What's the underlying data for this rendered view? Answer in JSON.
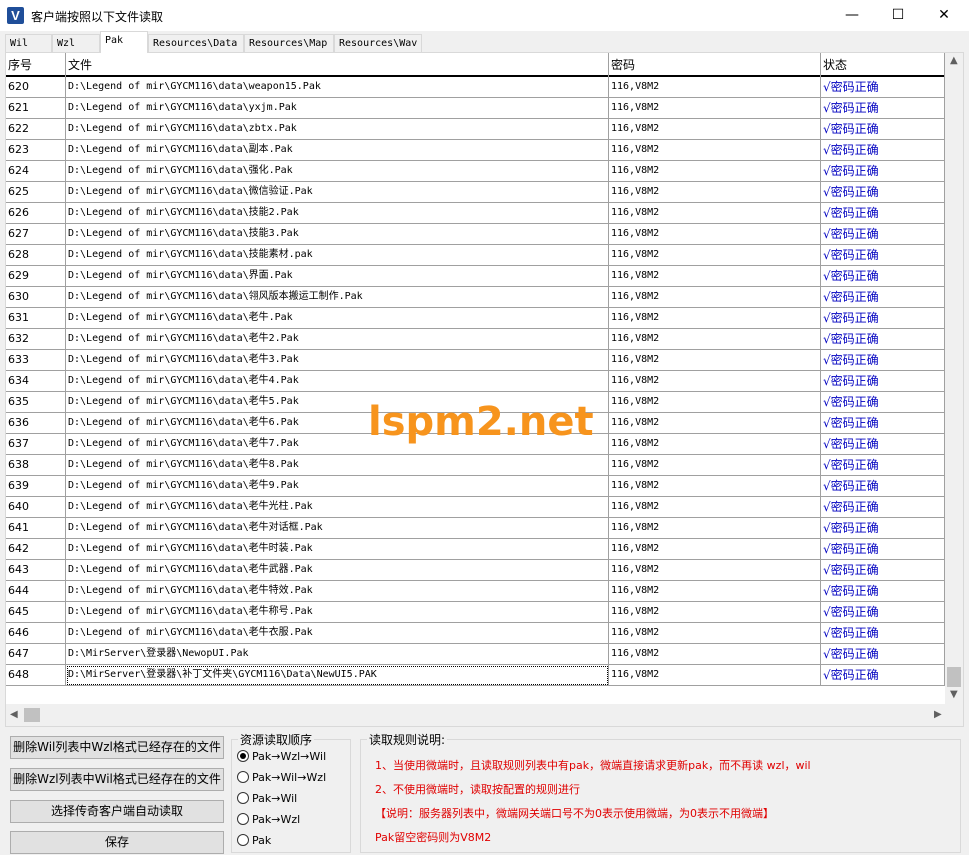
{
  "window": {
    "title": "客户端按照以下文件读取",
    "icon": "V",
    "min": "—",
    "max": "☐",
    "close": "✕"
  },
  "tabs": [
    "Wil",
    "Wzl",
    "Pak",
    "Resources\\Data",
    "Resources\\Map",
    "Resources\\Wav"
  ],
  "active_tab": "Pak",
  "table": {
    "headers": [
      "序号",
      "文件",
      "密码",
      "状态"
    ],
    "rows": [
      [
        "620",
        "D:\\Legend of mir\\GYCM116\\data\\weapon15.Pak",
        "116,V8M2",
        "√密码正确"
      ],
      [
        "621",
        "D:\\Legend of mir\\GYCM116\\data\\yxjm.Pak",
        "116,V8M2",
        "√密码正确"
      ],
      [
        "622",
        "D:\\Legend of mir\\GYCM116\\data\\zbtx.Pak",
        "116,V8M2",
        "√密码正确"
      ],
      [
        "623",
        "D:\\Legend of mir\\GYCM116\\data\\副本.Pak",
        "116,V8M2",
        "√密码正确"
      ],
      [
        "624",
        "D:\\Legend of mir\\GYCM116\\data\\强化.Pak",
        "116,V8M2",
        "√密码正确"
      ],
      [
        "625",
        "D:\\Legend of mir\\GYCM116\\data\\微信验证.Pak",
        "116,V8M2",
        "√密码正确"
      ],
      [
        "626",
        "D:\\Legend of mir\\GYCM116\\data\\技能2.Pak",
        "116,V8M2",
        "√密码正确"
      ],
      [
        "627",
        "D:\\Legend of mir\\GYCM116\\data\\技能3.Pak",
        "116,V8M2",
        "√密码正确"
      ],
      [
        "628",
        "D:\\Legend of mir\\GYCM116\\data\\技能素材.pak",
        "116,V8M2",
        "√密码正确"
      ],
      [
        "629",
        "D:\\Legend of mir\\GYCM116\\data\\界面.Pak",
        "116,V8M2",
        "√密码正确"
      ],
      [
        "630",
        "D:\\Legend of mir\\GYCM116\\data\\翎风版本搬运工制作.Pak",
        "116,V8M2",
        "√密码正确"
      ],
      [
        "631",
        "D:\\Legend of mir\\GYCM116\\data\\老牛.Pak",
        "116,V8M2",
        "√密码正确"
      ],
      [
        "632",
        "D:\\Legend of mir\\GYCM116\\data\\老牛2.Pak",
        "116,V8M2",
        "√密码正确"
      ],
      [
        "633",
        "D:\\Legend of mir\\GYCM116\\data\\老牛3.Pak",
        "116,V8M2",
        "√密码正确"
      ],
      [
        "634",
        "D:\\Legend of mir\\GYCM116\\data\\老牛4.Pak",
        "116,V8M2",
        "√密码正确"
      ],
      [
        "635",
        "D:\\Legend of mir\\GYCM116\\data\\老牛5.Pak",
        "116,V8M2",
        "√密码正确"
      ],
      [
        "636",
        "D:\\Legend of mir\\GYCM116\\data\\老牛6.Pak",
        "116,V8M2",
        "√密码正确"
      ],
      [
        "637",
        "D:\\Legend of mir\\GYCM116\\data\\老牛7.Pak",
        "116,V8M2",
        "√密码正确"
      ],
      [
        "638",
        "D:\\Legend of mir\\GYCM116\\data\\老牛8.Pak",
        "116,V8M2",
        "√密码正确"
      ],
      [
        "639",
        "D:\\Legend of mir\\GYCM116\\data\\老牛9.Pak",
        "116,V8M2",
        "√密码正确"
      ],
      [
        "640",
        "D:\\Legend of mir\\GYCM116\\data\\老牛光柱.Pak",
        "116,V8M2",
        "√密码正确"
      ],
      [
        "641",
        "D:\\Legend of mir\\GYCM116\\data\\老牛对话框.Pak",
        "116,V8M2",
        "√密码正确"
      ],
      [
        "642",
        "D:\\Legend of mir\\GYCM116\\data\\老牛时装.Pak",
        "116,V8M2",
        "√密码正确"
      ],
      [
        "643",
        "D:\\Legend of mir\\GYCM116\\data\\老牛武器.Pak",
        "116,V8M2",
        "√密码正确"
      ],
      [
        "644",
        "D:\\Legend of mir\\GYCM116\\data\\老牛特效.Pak",
        "116,V8M2",
        "√密码正确"
      ],
      [
        "645",
        "D:\\Legend of mir\\GYCM116\\data\\老牛称号.Pak",
        "116,V8M2",
        "√密码正确"
      ],
      [
        "646",
        "D:\\Legend of mir\\GYCM116\\data\\老牛衣服.Pak",
        "116,V8M2",
        "√密码正确"
      ],
      [
        "647",
        "D:\\MirServer\\登录器\\NewopUI.Pak",
        "116,V8M2",
        "√密码正确"
      ],
      [
        "648",
        "D:\\MirServer\\登录器\\补丁文件夹\\GYCM116\\Data\\NewUI5.PAK",
        "116,V8M2",
        "√密码正确"
      ]
    ]
  },
  "watermark": "lspm2.net",
  "buttons": {
    "delete_wil": "删除Wil列表中Wzl格式已经存在的文件",
    "delete_wzl": "删除Wzl列表中Wil格式已经存在的文件",
    "auto_read": "选择传奇客户端自动读取",
    "save": "保存"
  },
  "order_group": {
    "title": "资源读取顺序",
    "options": [
      "Pak→Wzl→Wil",
      "Pak→Wil→Wzl",
      "Pak→Wil",
      "Pak→Wzl",
      "Pak"
    ],
    "selected": 0
  },
  "rules_group": {
    "title": "读取规则说明:",
    "lines": [
      "1、当使用微端时，且读取规则列表中有pak，微端直接请求更新pak，而不再读 wzl，wil",
      "2、不使用微端时，读取按配置的规则进行",
      "【说明：服务器列表中，微端网关端口号不为0表示使用微端，为0表示不用微端】",
      "Pak留空密码则为V8M2"
    ]
  }
}
